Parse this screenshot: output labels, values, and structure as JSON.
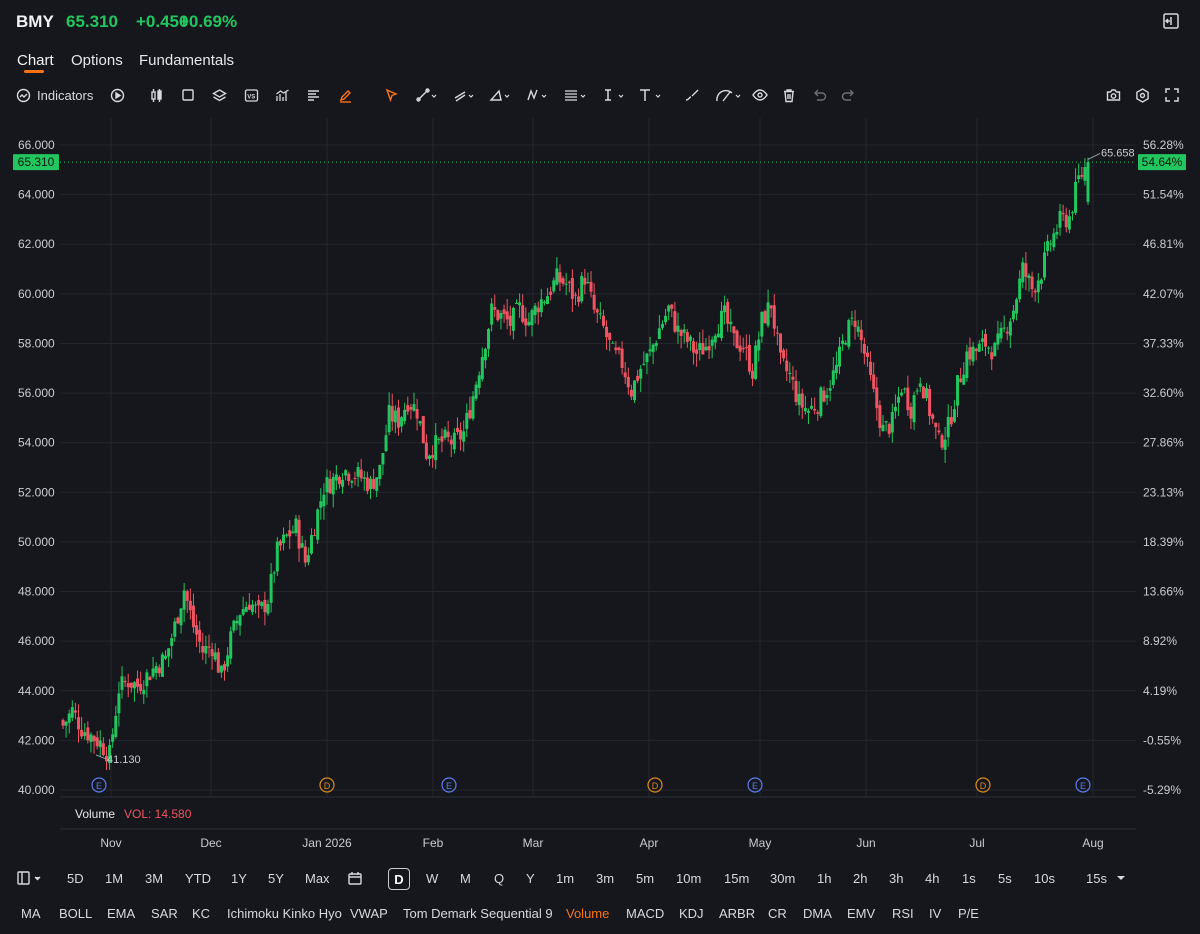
{
  "header": {
    "symbol": "BMY",
    "price": "65.310",
    "change": "+0.450",
    "change_pct": "+0.69%",
    "accent_up": "#22c55e",
    "accent_down": "#f05462",
    "accent_active": "#f97316",
    "exit_icon": "exit-fullscreen-icon"
  },
  "tabs": [
    {
      "label": "Chart",
      "active": true
    },
    {
      "label": "Options"
    },
    {
      "label": "Fundamentals"
    }
  ],
  "toolbar": {
    "indicators_label": "Indicators",
    "left_icons": [
      "replay-icon",
      "candlestick-icon",
      "square-icon",
      "layers-icon",
      "vs-icon",
      "chart-settings-icon",
      "align-icon",
      "pencil-icon"
    ],
    "drawing_icons": [
      "cursor-icon",
      "line-tool-icon",
      "ray-tool-icon",
      "angle-tool-icon",
      "pattern-tool-icon",
      "fib-tool-icon",
      "text-cursor-icon",
      "text-tool-icon",
      "brush-tool-icon",
      "measure-tool-icon",
      "eye-icon",
      "trash-icon",
      "undo-icon",
      "redo-icon"
    ],
    "right_icons": [
      "camera-icon",
      "settings-icon",
      "fullscreen-icon"
    ]
  },
  "chart_data": {
    "type": "candlestick",
    "y_left_ticks": [
      "66.000",
      "64.000",
      "62.000",
      "60.000",
      "58.000",
      "56.000",
      "54.000",
      "52.000",
      "50.000",
      "48.000",
      "46.000",
      "44.000",
      "42.000",
      "40.000"
    ],
    "y_right_ticks": [
      "56.28%",
      "51.54%",
      "46.81%",
      "42.07%",
      "37.33%",
      "32.60%",
      "27.86%",
      "23.13%",
      "18.39%",
      "13.66%",
      "8.92%",
      "4.19%",
      "-0.55%",
      "-5.29%"
    ],
    "ylim": [
      40,
      66
    ],
    "x_labels": [
      "Nov",
      "Dec",
      "Jan 2026",
      "Feb",
      "Mar",
      "Apr",
      "May",
      "Jun",
      "Jul",
      "Aug"
    ],
    "current_price_label": "65.310",
    "current_pct_label": "54.64%",
    "high_label": "65.658",
    "low_label": "41.130",
    "events": [
      "E",
      "D",
      "E",
      "D",
      "E",
      "D",
      "E"
    ],
    "close_path": [
      [
        0,
        42.6
      ],
      [
        3,
        43.2
      ],
      [
        6,
        42.5
      ],
      [
        9,
        42.2
      ],
      [
        12,
        41.9
      ],
      [
        15,
        41.4
      ],
      [
        18,
        44.1
      ],
      [
        21,
        44.4
      ],
      [
        24,
        44.2
      ],
      [
        27,
        44.6
      ],
      [
        30,
        45.0
      ],
      [
        33,
        45.3
      ],
      [
        36,
        46.6
      ],
      [
        39,
        48.1
      ],
      [
        42,
        46.6
      ],
      [
        45,
        45.6
      ],
      [
        48,
        45.8
      ],
      [
        51,
        44.6
      ],
      [
        54,
        46.1
      ],
      [
        57,
        47.2
      ],
      [
        60,
        47.6
      ],
      [
        63,
        47.1
      ],
      [
        66,
        47.7
      ],
      [
        69,
        49.6
      ],
      [
        72,
        50.2
      ],
      [
        75,
        50.6
      ],
      [
        78,
        49.2
      ],
      [
        81,
        50.7
      ],
      [
        84,
        52.2
      ],
      [
        87,
        52.5
      ],
      [
        90,
        52.9
      ],
      [
        93,
        52.8
      ],
      [
        96,
        52.6
      ],
      [
        99,
        52.3
      ],
      [
        102,
        52.9
      ],
      [
        105,
        55.1
      ],
      [
        108,
        54.9
      ],
      [
        111,
        55.7
      ],
      [
        114,
        55.3
      ],
      [
        117,
        53.6
      ],
      [
        120,
        53.9
      ],
      [
        123,
        54.1
      ],
      [
        126,
        54.0
      ],
      [
        129,
        54.4
      ],
      [
        132,
        55.9
      ],
      [
        135,
        57.6
      ],
      [
        138,
        59.3
      ],
      [
        141,
        59.1
      ],
      [
        144,
        58.8
      ],
      [
        147,
        59.4
      ],
      [
        150,
        58.9
      ],
      [
        153,
        59.6
      ],
      [
        156,
        60.0
      ],
      [
        159,
        60.6
      ],
      [
        162,
        60.4
      ],
      [
        165,
        59.8
      ],
      [
        168,
        60.7
      ],
      [
        171,
        59.3
      ],
      [
        174,
        58.6
      ],
      [
        177,
        57.6
      ],
      [
        180,
        57.2
      ],
      [
        183,
        56.1
      ],
      [
        186,
        57.0
      ],
      [
        189,
        57.6
      ],
      [
        192,
        58.6
      ],
      [
        195,
        59.4
      ],
      [
        198,
        58.5
      ],
      [
        201,
        58.1
      ],
      [
        204,
        57.6
      ],
      [
        207,
        57.9
      ],
      [
        210,
        58.7
      ],
      [
        213,
        59.1
      ],
      [
        216,
        58.1
      ],
      [
        219,
        57.9
      ],
      [
        222,
        56.9
      ],
      [
        225,
        58.9
      ],
      [
        228,
        59.6
      ],
      [
        231,
        57.2
      ],
      [
        234,
        56.7
      ],
      [
        237,
        55.6
      ],
      [
        240,
        55.3
      ],
      [
        243,
        55.6
      ],
      [
        246,
        56.2
      ],
      [
        249,
        57.0
      ],
      [
        252,
        58.4
      ],
      [
        255,
        59.0
      ],
      [
        258,
        57.6
      ],
      [
        261,
        55.9
      ],
      [
        264,
        54.5
      ],
      [
        267,
        54.8
      ],
      [
        270,
        56.3
      ],
      [
        273,
        55.4
      ],
      [
        276,
        56.7
      ],
      [
        279,
        55.3
      ],
      [
        282,
        54.0
      ],
      [
        285,
        54.6
      ],
      [
        288,
        56.3
      ],
      [
        291,
        57.6
      ],
      [
        294,
        57.7
      ],
      [
        297,
        58.0
      ],
      [
        300,
        57.7
      ],
      [
        303,
        58.5
      ],
      [
        306,
        59.4
      ],
      [
        309,
        61.0
      ],
      [
        312,
        60.2
      ],
      [
        315,
        60.9
      ],
      [
        318,
        62.1
      ],
      [
        321,
        62.9
      ],
      [
        324,
        63.1
      ],
      [
        327,
        64.6
      ],
      [
        330,
        65.3
      ]
    ]
  },
  "volume": {
    "label": "Volume",
    "value_label": "VOL: 14.580"
  },
  "intervals": {
    "ranges": [
      "5D",
      "1M",
      "3M",
      "YTD",
      "1Y",
      "5Y",
      "Max"
    ],
    "periods": [
      "D",
      "W",
      "M",
      "Q",
      "Y",
      "1m",
      "3m",
      "5m",
      "10m",
      "15m",
      "30m",
      "1h",
      "2h",
      "3h",
      "4h",
      "1s",
      "5s",
      "10s"
    ],
    "selected": "D",
    "dropdown_value": "15s"
  },
  "indicators": [
    "MA",
    "BOLL",
    "EMA",
    "SAR",
    "KC",
    "Ichimoku Kinko Hyo",
    "VWAP",
    "Tom Demark Sequential 9",
    "Volume",
    "MACD",
    "KDJ",
    "ARBR",
    "CR",
    "DMA",
    "EMV",
    "RSI",
    "IV",
    "P/E"
  ],
  "indicators_active": "Volume"
}
